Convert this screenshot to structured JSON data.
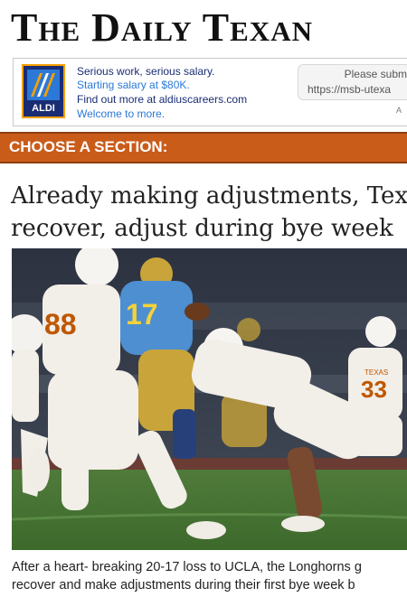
{
  "masthead": {
    "title": "The Daily Texan"
  },
  "ad": {
    "logo_text": "ALDI",
    "line1": "Serious work, serious salary.",
    "line2": "Starting salary at $80K.",
    "line3": "Find out more at aldiuscareers.com",
    "line4": "Welcome to more.",
    "form_label": "Please subm",
    "form_url": "https://msb-utexa",
    "form_small": "A",
    "colors": {
      "navy": "#1a2d73",
      "blue": "#2b78d6",
      "orange": "#f5a000"
    }
  },
  "section_bar": {
    "label": "CHOOSE A SECTION:",
    "color": "#ca5c1a"
  },
  "article": {
    "headline_line1": "Already making adjustments, Texas",
    "headline_line2": "recover, adjust during bye week",
    "caption_line1": "After a heart- breaking 20-17 loss to UCLA, the Longhorns g",
    "caption_line2": "recover and make adjustments during their first bye week b"
  },
  "photo": {
    "jersey_88": "88",
    "jersey_17": "17",
    "jersey_33": "33",
    "jersey_text": "TEXAS"
  }
}
